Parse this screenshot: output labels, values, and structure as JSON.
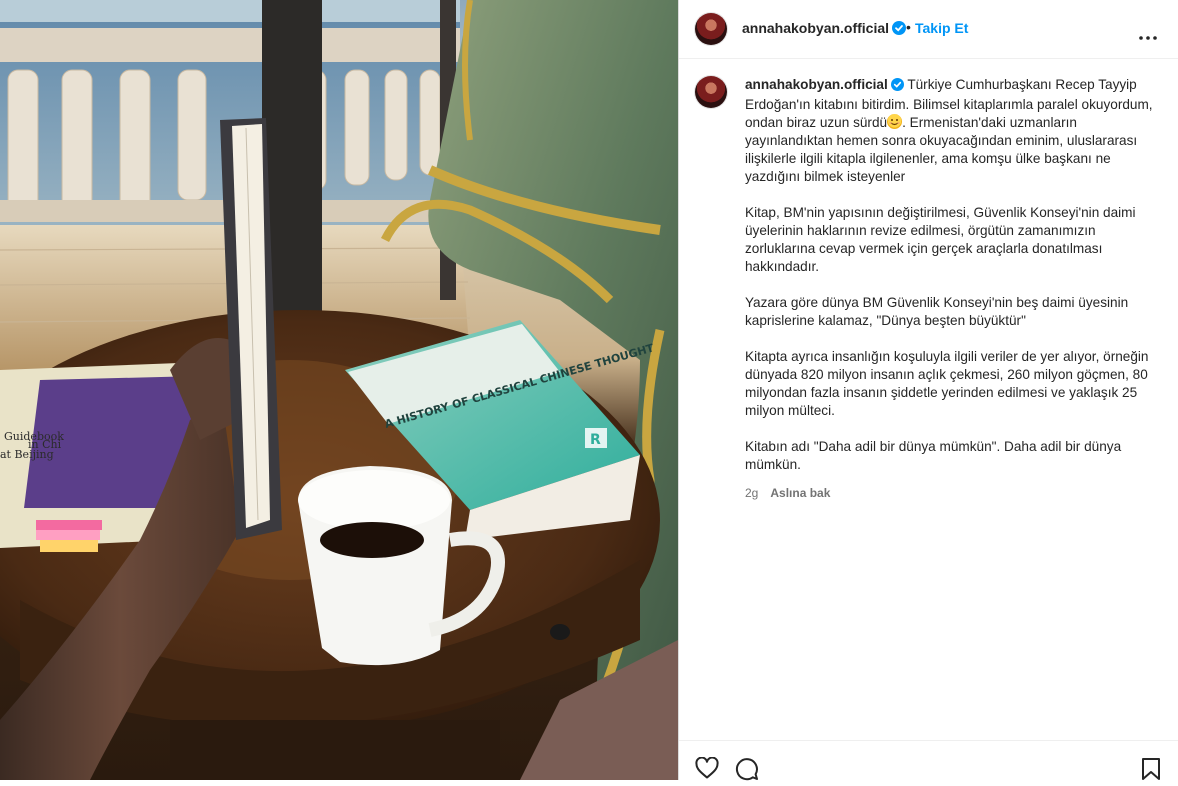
{
  "post": {
    "username": "annahakobyan.official",
    "separator": "•",
    "follow_label": "Takip Et",
    "caption_paragraphs": [
      "Türkiye Cumhurbaşkanı Recep Tayyip Erdoğan'ın kitabını bitirdim. Bilimsel kitaplarımla paralel okuyordum, ondan biraz uzun sürdü",
      "Kitap, BM'nin yapısının değiştirilmesi, Güvenlik Konseyi'nin daimi üyelerinin haklarının revize edilmesi, örgütün zamanımızın zorluklarına cevap vermek için gerçek araçlarla donatılması hakkındadır.",
      "Yazara göre dünya BM Güvenlik Konseyi'nin beş daimi üyesinin kaprislerine kalamaz, \"Dünya beşten büyüktür\"",
      "Kitapta ayrıca insanlığın koşuluyla ilgili veriler de yer alıyor, örneğin dünyada 820 milyon insanın açlık çekmesi, 260 milyon göçmen, 80 milyondan fazla insanın şiddetle yerinden edilmesi ve yaklaşık 25 milyon mülteci.",
      "Kitabın adı \"Daha adil bir dünya mümkün\". Daha adil bir dünya mümkün."
    ],
    "caption_after_emoji": ". Ermenistan'daki uzmanların yayınlandıktan hemen sonra okuyacağından eminim, uluslararası ilişkilerle ilgili kitapla ilgilenenler, ama komşu ülke başkanı ne yazdığını bilmek isteyenler",
    "emoji_icon": "smiling-face-emoji",
    "time_ago": "2g",
    "see_translation": "Aslına bak",
    "book_cover_title": "A HISTORY OF CLASSICAL CHINESE THOUGHT",
    "book_publisher_mark": "R",
    "guidebook_text": [
      "Guidebook",
      "in Chi",
      "at Beijing"
    ]
  },
  "colors": {
    "accent": "#0095f6",
    "verified": "#0095f6",
    "text": "#262626",
    "muted": "#737373",
    "border": "#dbdbdb"
  },
  "icons": [
    "verified-badge-icon",
    "more-options-icon",
    "heart-icon",
    "comment-icon",
    "bookmark-icon"
  ]
}
